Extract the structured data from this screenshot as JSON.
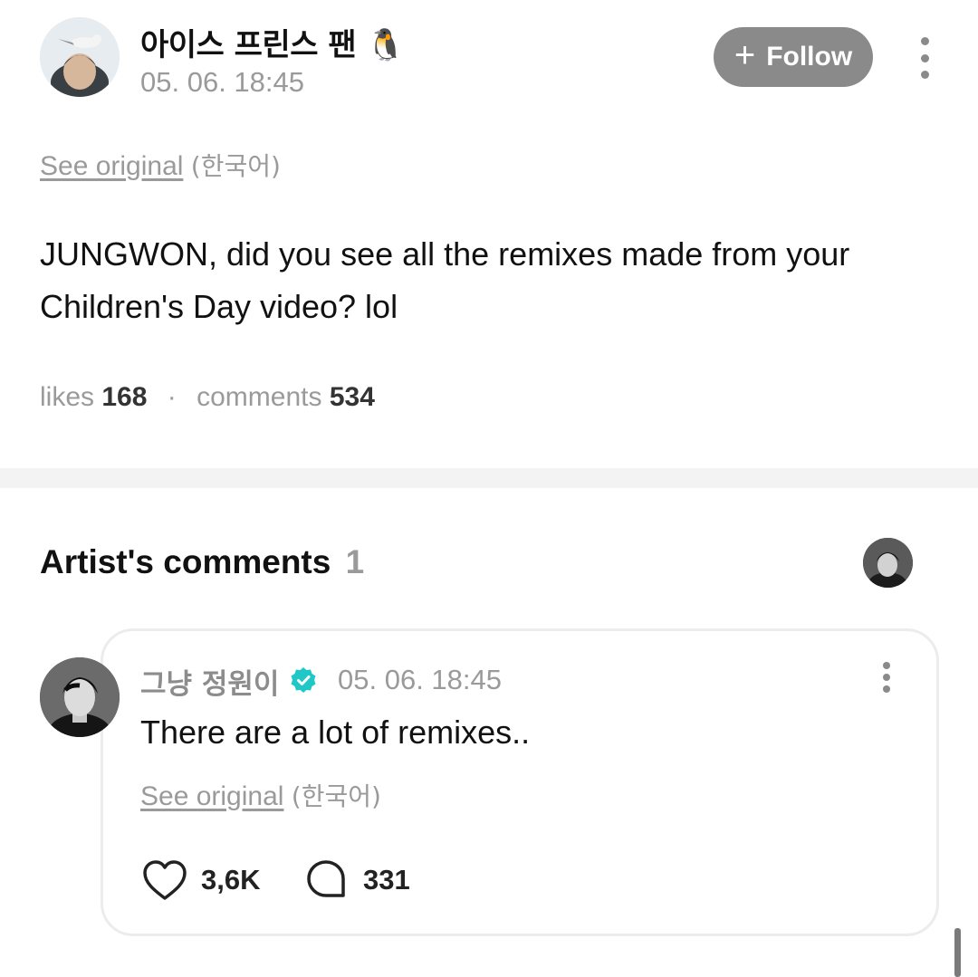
{
  "post": {
    "author": "아이스 프린스 팬 🐧",
    "timestamp": "05. 06. 18:45",
    "follow_label": "Follow",
    "see_original": "See original",
    "original_language": "(한국어)",
    "body": "JUNGWON, did you see all the remixes made from your Children's Day video? lol",
    "likes_label": "likes",
    "likes_count": "168",
    "comments_label": "comments",
    "comments_count": "534"
  },
  "artist_comments": {
    "title": "Artist's comments",
    "count": "1",
    "comment": {
      "author": "그냥 정원이",
      "timestamp": "05. 06. 18:45",
      "text": "There are a lot of remixes..",
      "see_original": "See original",
      "original_language": "(한국어)",
      "likes": "3,6K",
      "replies": "331"
    }
  },
  "colors": {
    "follow_button_bg": "#8a8a8a",
    "verified_badge": "#1fc7c7",
    "muted_text": "#9a9a9a",
    "divider": "#f3f3f3"
  },
  "icons": [
    "plus-icon",
    "more-vertical-icon",
    "verified-badge-icon",
    "heart-icon",
    "comment-bubble-icon"
  ]
}
